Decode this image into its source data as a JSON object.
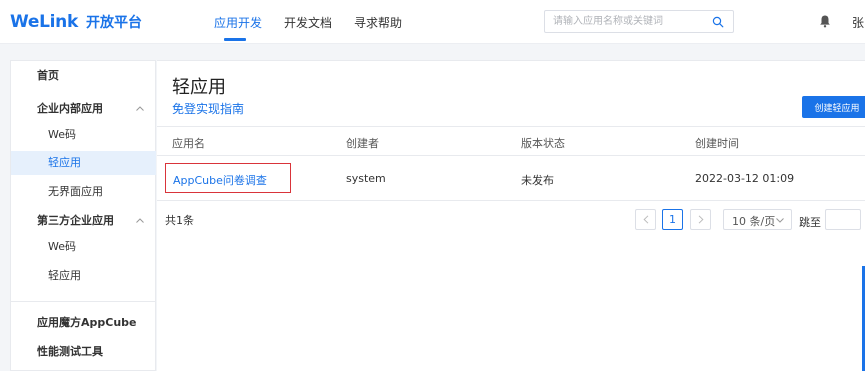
{
  "header": {
    "brand": "WeLink",
    "brand_sub": "开放平台",
    "tabs": [
      {
        "label": "应用开发",
        "active": true
      },
      {
        "label": "开发文档",
        "active": false
      },
      {
        "label": "寻求帮助",
        "active": false
      }
    ],
    "search_placeholder": "请输入应用名称或关键词",
    "user_name": "张",
    "accent": "#1a73e8"
  },
  "sidebar": {
    "items": [
      {
        "label": "首页"
      },
      {
        "label": "企业内部应用",
        "expanded": true
      },
      {
        "label": "We码"
      },
      {
        "label": "轻应用",
        "selected": true
      },
      {
        "label": "无界面应用"
      },
      {
        "label": "第三方企业应用",
        "expanded": true
      },
      {
        "label": "We码"
      },
      {
        "label": "轻应用"
      },
      {
        "label": "应用魔方AppCube"
      },
      {
        "label": "性能测试工具"
      }
    ]
  },
  "main": {
    "title": "轻应用",
    "guide_link": "免登实现指南",
    "create_button": "创建轻应用",
    "columns": [
      "应用名",
      "创建者",
      "版本状态",
      "创建时间"
    ],
    "rows": [
      {
        "name": "AppCube问卷调查",
        "creator": "system",
        "status": "未发布",
        "created": "2022-03-12 01:09"
      }
    ],
    "highlight_color": "#d9343a"
  },
  "pagination": {
    "total": "共1条",
    "current_page": "1",
    "page_size": "10 条/页",
    "jump_label": "跳至"
  }
}
